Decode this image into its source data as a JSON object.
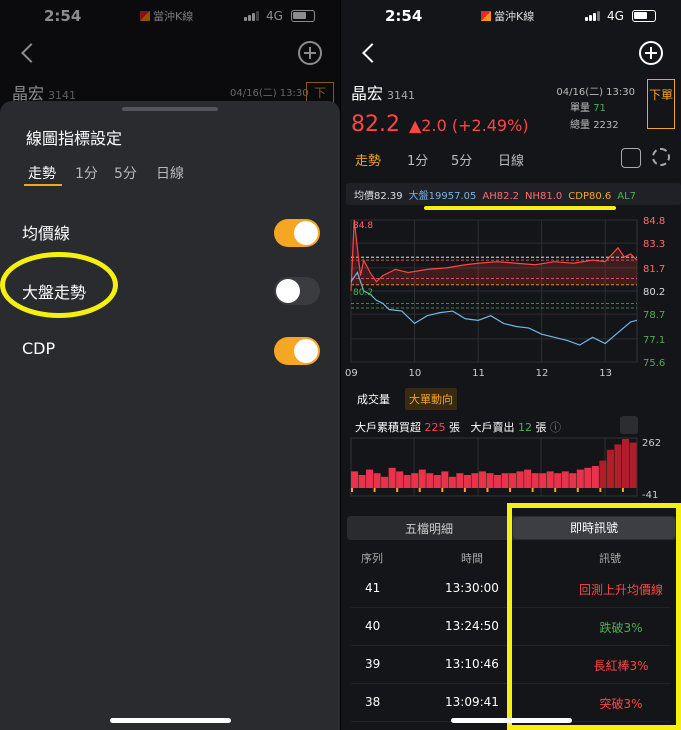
{
  "left": {
    "status": {
      "time": "2:54",
      "app": "當沖K線",
      "network": "4G"
    },
    "stock": {
      "name": "晶宏",
      "code": "3141",
      "datetime": "04/16(二) 13:30",
      "sell": "下"
    },
    "sheet": {
      "title": "線圖指標設定",
      "tabs": [
        "走勢",
        "1分",
        "5分",
        "日線"
      ],
      "settings": [
        {
          "label": "均價線",
          "on": true
        },
        {
          "label": "大盤走勢",
          "on": false
        },
        {
          "label": "CDP",
          "on": true
        }
      ]
    }
  },
  "right": {
    "status": {
      "time": "2:54",
      "app": "當沖K線",
      "network": "4G"
    },
    "stock": {
      "name": "晶宏",
      "code": "3141",
      "price": "82.2",
      "change": "▲2.0 (+2.49%)",
      "datetime": "04/16(二) 13:30",
      "vol_label": "單量",
      "vol": "71",
      "total_label": "總量",
      "total": "2232",
      "sell": "下單"
    },
    "tabs": [
      "走勢",
      "1分",
      "5分",
      "日線"
    ],
    "indicators": {
      "avg": "均價82.39",
      "index": "大盤19957.05",
      "ah": "AH82.2",
      "nh": "NH81.0",
      "cdp": "CDP80.6",
      "al": "AL7"
    },
    "chart_data": {
      "type": "line",
      "x_ticks": [
        "09",
        "10",
        "11",
        "12",
        "13"
      ],
      "y_ticks": [
        84.8,
        83.3,
        81.7,
        80.2,
        78.7,
        77.1,
        75.6
      ],
      "markers": {
        "high": "84.8",
        "low": "80.2"
      },
      "ylim": [
        75.6,
        84.8
      ],
      "series": [
        {
          "name": "價格",
          "color": "#ff4545",
          "x": [
            9.0,
            9.05,
            9.1,
            9.15,
            9.2,
            9.3,
            9.4,
            9.5,
            9.7,
            9.9,
            10.2,
            10.5,
            10.8,
            11.0,
            11.3,
            11.6,
            11.9,
            12.2,
            12.5,
            12.8,
            13.0,
            13.2,
            13.3,
            13.4,
            13.5
          ],
          "y": [
            80.2,
            84.8,
            83.0,
            81.2,
            82.2,
            81.4,
            80.8,
            81.2,
            81.6,
            81.4,
            81.6,
            81.7,
            81.9,
            82.0,
            82.1,
            82.0,
            81.9,
            82.1,
            82.0,
            82.2,
            82.1,
            83.0,
            82.4,
            82.6,
            82.2
          ]
        },
        {
          "name": "大盤",
          "color": "#6fb6e8",
          "x": [
            9.0,
            9.1,
            9.2,
            9.3,
            9.4,
            9.5,
            9.6,
            9.8,
            10.0,
            10.2,
            10.4,
            10.6,
            10.8,
            11.0,
            11.2,
            11.4,
            11.6,
            11.8,
            12.0,
            12.2,
            12.4,
            12.6,
            12.8,
            13.0,
            13.2,
            13.4,
            13.5
          ],
          "y": [
            80.8,
            81.4,
            80.2,
            80.0,
            79.6,
            79.4,
            79.0,
            78.9,
            78.1,
            78.6,
            78.8,
            78.9,
            78.4,
            78.3,
            78.6,
            78.1,
            77.9,
            77.8,
            77.4,
            77.2,
            77.0,
            76.7,
            77.2,
            76.8,
            77.5,
            78.2,
            78.3
          ]
        }
      ],
      "ref_lines": [
        {
          "y": 82.39,
          "color": "#ffffff"
        },
        {
          "y": 82.2,
          "color": "#ff6b6b"
        },
        {
          "y": 81.0,
          "color": "#ff6b6b"
        },
        {
          "y": 80.6,
          "color": "#f5a524"
        },
        {
          "y": 79.4,
          "color": "#4caf50"
        },
        {
          "y": 79.1,
          "color": "#4caf50"
        }
      ]
    },
    "volume_tabs": [
      "成交量",
      "大單動向"
    ],
    "volume_info": {
      "buy_label": "大戶累積買超",
      "buy": "225",
      "unit": "張",
      "sell_label": "大戶賣出",
      "sell": "12"
    },
    "volume_chart": {
      "ymax": "262",
      "ymin": "-41"
    },
    "sections": [
      "五檔明細",
      "即時訊號"
    ],
    "table": {
      "headers": [
        "序列",
        "時間",
        "訊號"
      ],
      "rows": [
        {
          "seq": "41",
          "time": "13:30:00",
          "signal": "回測上升均價線",
          "color": "#ff4545"
        },
        {
          "seq": "40",
          "time": "13:24:50",
          "signal": "跌破3%",
          "color": "#4caf50"
        },
        {
          "seq": "39",
          "time": "13:10:46",
          "signal": "長紅棒3%",
          "color": "#ff4545"
        },
        {
          "seq": "38",
          "time": "13:09:41",
          "signal": "突破3%",
          "color": "#ff4545"
        }
      ]
    }
  }
}
